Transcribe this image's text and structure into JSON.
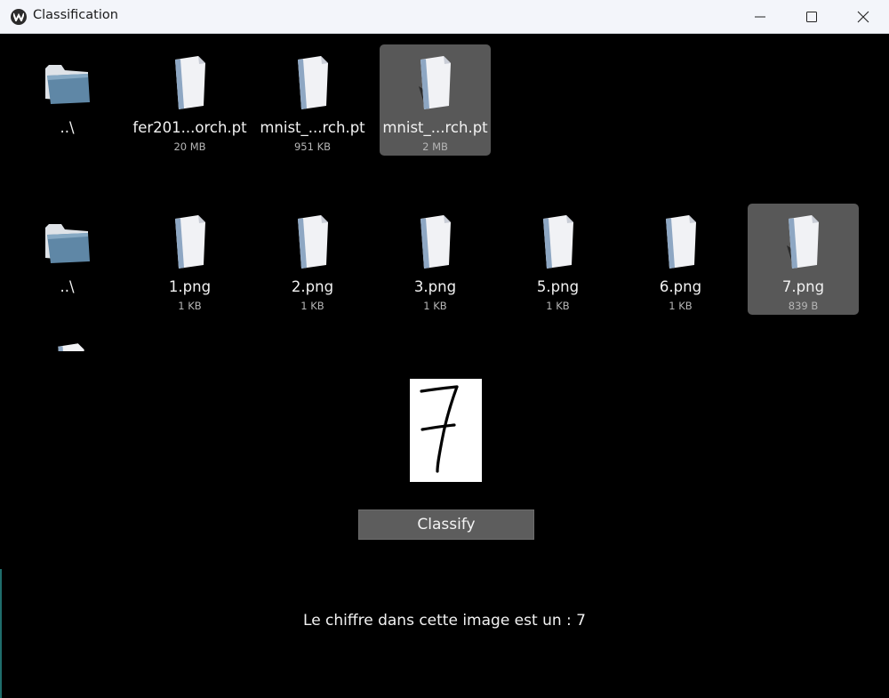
{
  "window": {
    "title": "Classification",
    "controls": [
      "minimize-icon",
      "maximize-icon",
      "close-icon"
    ]
  },
  "model_files": [
    {
      "name": "..\\",
      "size": "",
      "icon": "folder-icon"
    },
    {
      "name": "fer201...orch.pt",
      "size": "20 MB",
      "icon": "file-icon"
    },
    {
      "name": "mnist_...rch.pt",
      "size": "951 KB",
      "icon": "file-icon"
    },
    {
      "name": "mnist_...rch.pt",
      "size": "2 MB",
      "icon": "file-icon",
      "selected": true
    }
  ],
  "image_files": [
    {
      "name": "..\\",
      "size": "",
      "icon": "folder-icon"
    },
    {
      "name": "1.png",
      "size": "1 KB",
      "icon": "file-icon"
    },
    {
      "name": "2.png",
      "size": "1 KB",
      "icon": "file-icon"
    },
    {
      "name": "3.png",
      "size": "1 KB",
      "icon": "file-icon"
    },
    {
      "name": "5.png",
      "size": "1 KB",
      "icon": "file-icon"
    },
    {
      "name": "6.png",
      "size": "1 KB",
      "icon": "file-icon"
    },
    {
      "name": "7.png",
      "size": "839 B",
      "icon": "file-icon",
      "selected": true
    }
  ],
  "preview": {
    "icon": "handwritten-digit-image"
  },
  "classify_button": {
    "label": "Classify"
  },
  "result_text": "Le chiffre dans cette image est un : 7",
  "colors": {
    "background": "#000000",
    "selected_tile": "#585858",
    "button": "#5d5d5d",
    "titlebar": "#f3f5fa"
  }
}
